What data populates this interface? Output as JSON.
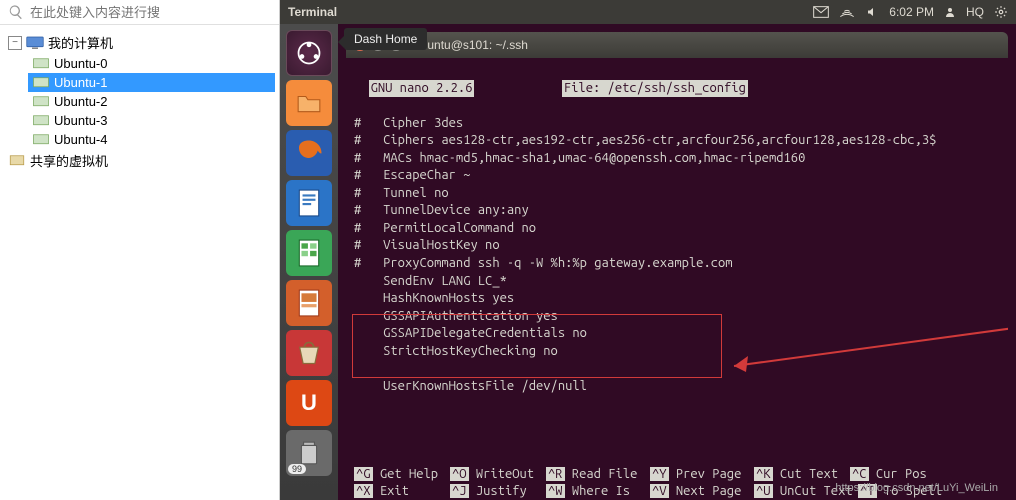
{
  "sidebar": {
    "search_placeholder": "在此处键入内容进行搜",
    "root_label": "我的计算机",
    "items": [
      {
        "label": "Ubuntu-0"
      },
      {
        "label": "Ubuntu-1"
      },
      {
        "label": "Ubuntu-2"
      },
      {
        "label": "Ubuntu-3"
      },
      {
        "label": "Ubuntu-4"
      }
    ],
    "shared_label": "共享的虚拟机"
  },
  "topbar": {
    "title": "Terminal",
    "time": "6:02 PM",
    "user": "HQ"
  },
  "tooltip": "Dash Home",
  "launcher_badge": "99",
  "terminal": {
    "titlebar": "ubuntu@s101: ~/.ssh",
    "nano_version": "GNU nano 2.2.6",
    "nano_file_label": "File: /etc/ssh/ssh_config",
    "lines": [
      "#   Cipher 3des",
      "#   Ciphers aes128-ctr,aes192-ctr,aes256-ctr,arcfour256,arcfour128,aes128-cbc,3$",
      "#   MACs hmac-md5,hmac-sha1,umac-64@openssh.com,hmac-ripemd160",
      "#   EscapeChar ~",
      "#   Tunnel no",
      "#   TunnelDevice any:any",
      "#   PermitLocalCommand no",
      "#   VisualHostKey no",
      "#   ProxyCommand ssh -q -W %h:%p gateway.example.com",
      "    SendEnv LANG LC_*",
      "    HashKnownHosts yes",
      "    GSSAPIAuthentication yes",
      "    GSSAPIDelegateCredentials no",
      "    StrictHostKeyChecking no",
      "",
      "    UserKnownHostsFile /dev/null"
    ],
    "footer": [
      {
        "key": "^G",
        "label": "Get Help"
      },
      {
        "key": "^O",
        "label": "WriteOut"
      },
      {
        "key": "^R",
        "label": "Read File"
      },
      {
        "key": "^Y",
        "label": "Prev Page"
      },
      {
        "key": "^K",
        "label": "Cut Text"
      },
      {
        "key": "^C",
        "label": "Cur Pos"
      },
      {
        "key": "^X",
        "label": "Exit"
      },
      {
        "key": "^J",
        "label": "Justify"
      },
      {
        "key": "^W",
        "label": "Where Is"
      },
      {
        "key": "^V",
        "label": "Next Page"
      },
      {
        "key": "^U",
        "label": "UnCut Text"
      },
      {
        "key": "^T",
        "label": "To Spell"
      }
    ]
  },
  "watermark": "https://blog.csdn.net/LuYi_WeiLin"
}
